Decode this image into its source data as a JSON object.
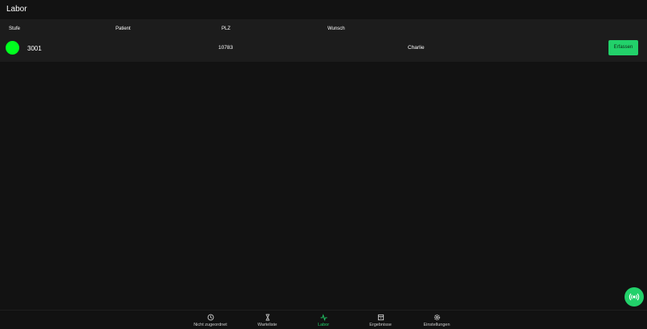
{
  "header": {
    "title": "Labor"
  },
  "table": {
    "columns": [
      "Stufe",
      "Patient",
      "PLZ",
      "Wunsch"
    ],
    "rows": [
      {
        "status_color": "#00ff1f",
        "id": "3001",
        "plz": "10783",
        "wunsch": "Charlie",
        "action_label": "Erfassen"
      }
    ]
  },
  "fab": {
    "icon": "broadcast-icon",
    "color": "#22d16a"
  },
  "bottom_nav": {
    "items": [
      {
        "label": "Nicht zugeordnet",
        "icon": "timer-icon"
      },
      {
        "label": "Warteliste",
        "icon": "hourglass-icon"
      },
      {
        "label": "Labor",
        "icon": "pulse-icon",
        "active": true
      },
      {
        "label": "Ergebnisse",
        "icon": "archive-icon"
      },
      {
        "label": "Einstellungen",
        "icon": "gear-icon"
      }
    ],
    "active_color": "#22d16a"
  }
}
